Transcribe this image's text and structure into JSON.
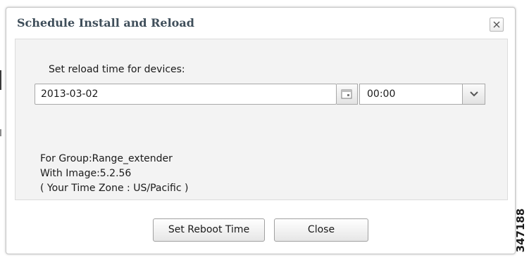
{
  "dialog": {
    "title": "Schedule Install and Reload",
    "close_icon": "close-x-icon"
  },
  "form": {
    "reload_label": "Set reload time for devices:",
    "date_value": "2013-03-02",
    "calendar_icon": "calendar-icon",
    "time_value": "00:00",
    "dropdown_icon": "chevron-down-icon"
  },
  "info": {
    "group": "For Group:Range_extender",
    "image": "With Image:5.2.56",
    "timezone": "( Your Time Zone : US/Pacific )"
  },
  "buttons": {
    "reboot_label": "Set Reboot Time",
    "close_label": "Close"
  },
  "figure_id": "347188",
  "colors": {
    "title": "#3f4e5a",
    "panel": "#f3f3f3",
    "border": "#a8a8a8"
  }
}
